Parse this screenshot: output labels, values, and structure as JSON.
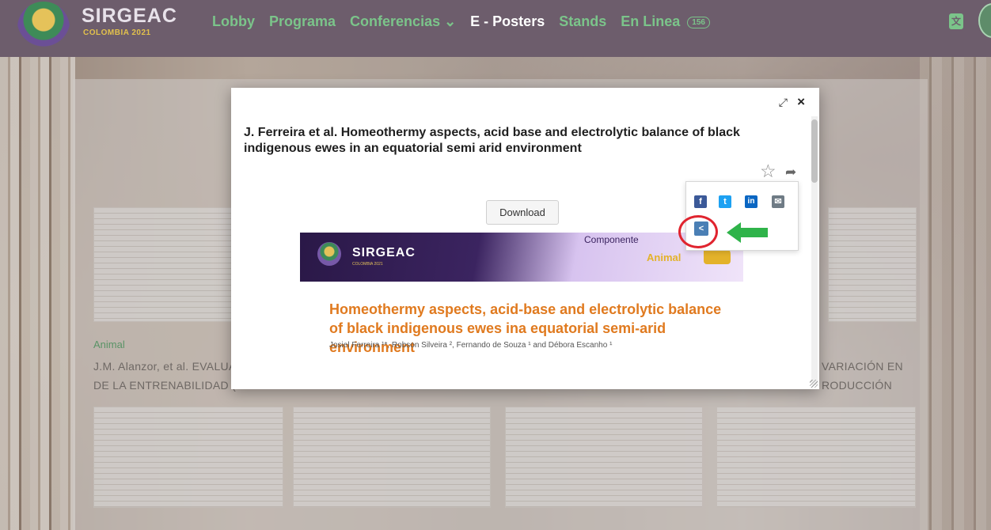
{
  "brand": {
    "title": "SIRGEAC",
    "subtitle": "COLOMBIA 2021"
  },
  "nav": {
    "items": [
      {
        "label": "Lobby",
        "active": false
      },
      {
        "label": "Programa",
        "active": false
      },
      {
        "label": "Conferencias ⌄",
        "active": false
      },
      {
        "label": "E - Posters",
        "active": true
      },
      {
        "label": "Stands",
        "active": false
      },
      {
        "label": "En Linea",
        "active": false
      }
    ],
    "online_count": "156"
  },
  "background": {
    "left_tag": "Animal",
    "left_title_line1": "J.M. Alanzor, et al. EVALUAC",
    "left_title_line2": "DE LA ENTRENABILIDAD (T",
    "right_title_line1": "VARIACIÓN EN",
    "right_title_line2": "RODUCCIÓN"
  },
  "modal": {
    "title": "J. Ferreira et al. Homeothermy aspects, acid base and electrolytic balance of black indigenous ewes in an equatorial semi arid environment",
    "download_label": "Download",
    "expand_glyph": "⤢",
    "close_glyph": "×",
    "star_glyph": "☆",
    "share_glyph": "➦"
  },
  "poster": {
    "brand": "SIRGEAC",
    "brand_sub": "COLOMBIA 2021",
    "component_label": "Componente",
    "component_value": "Animal",
    "heading": "Homeothermy aspects, acid-base and electrolytic balance of black indigenous ewes ina equatorial semi-arid environment",
    "authors": "Josiel Ferreira ¹*, Robson Silveira ², Fernando de Souza ¹ and Débora Escanho ¹"
  },
  "share_menu": {
    "facebook_glyph": "f",
    "twitter_glyph": "t",
    "linkedin_glyph": "in",
    "email_glyph": "✉",
    "link_glyph": "<"
  },
  "colors": {
    "nav_bg": "#6d5d6c",
    "nav_link": "#7bc48a",
    "highlight": "#e0242f",
    "arrow": "#2fb34a",
    "poster_heading": "#e07a1f"
  }
}
